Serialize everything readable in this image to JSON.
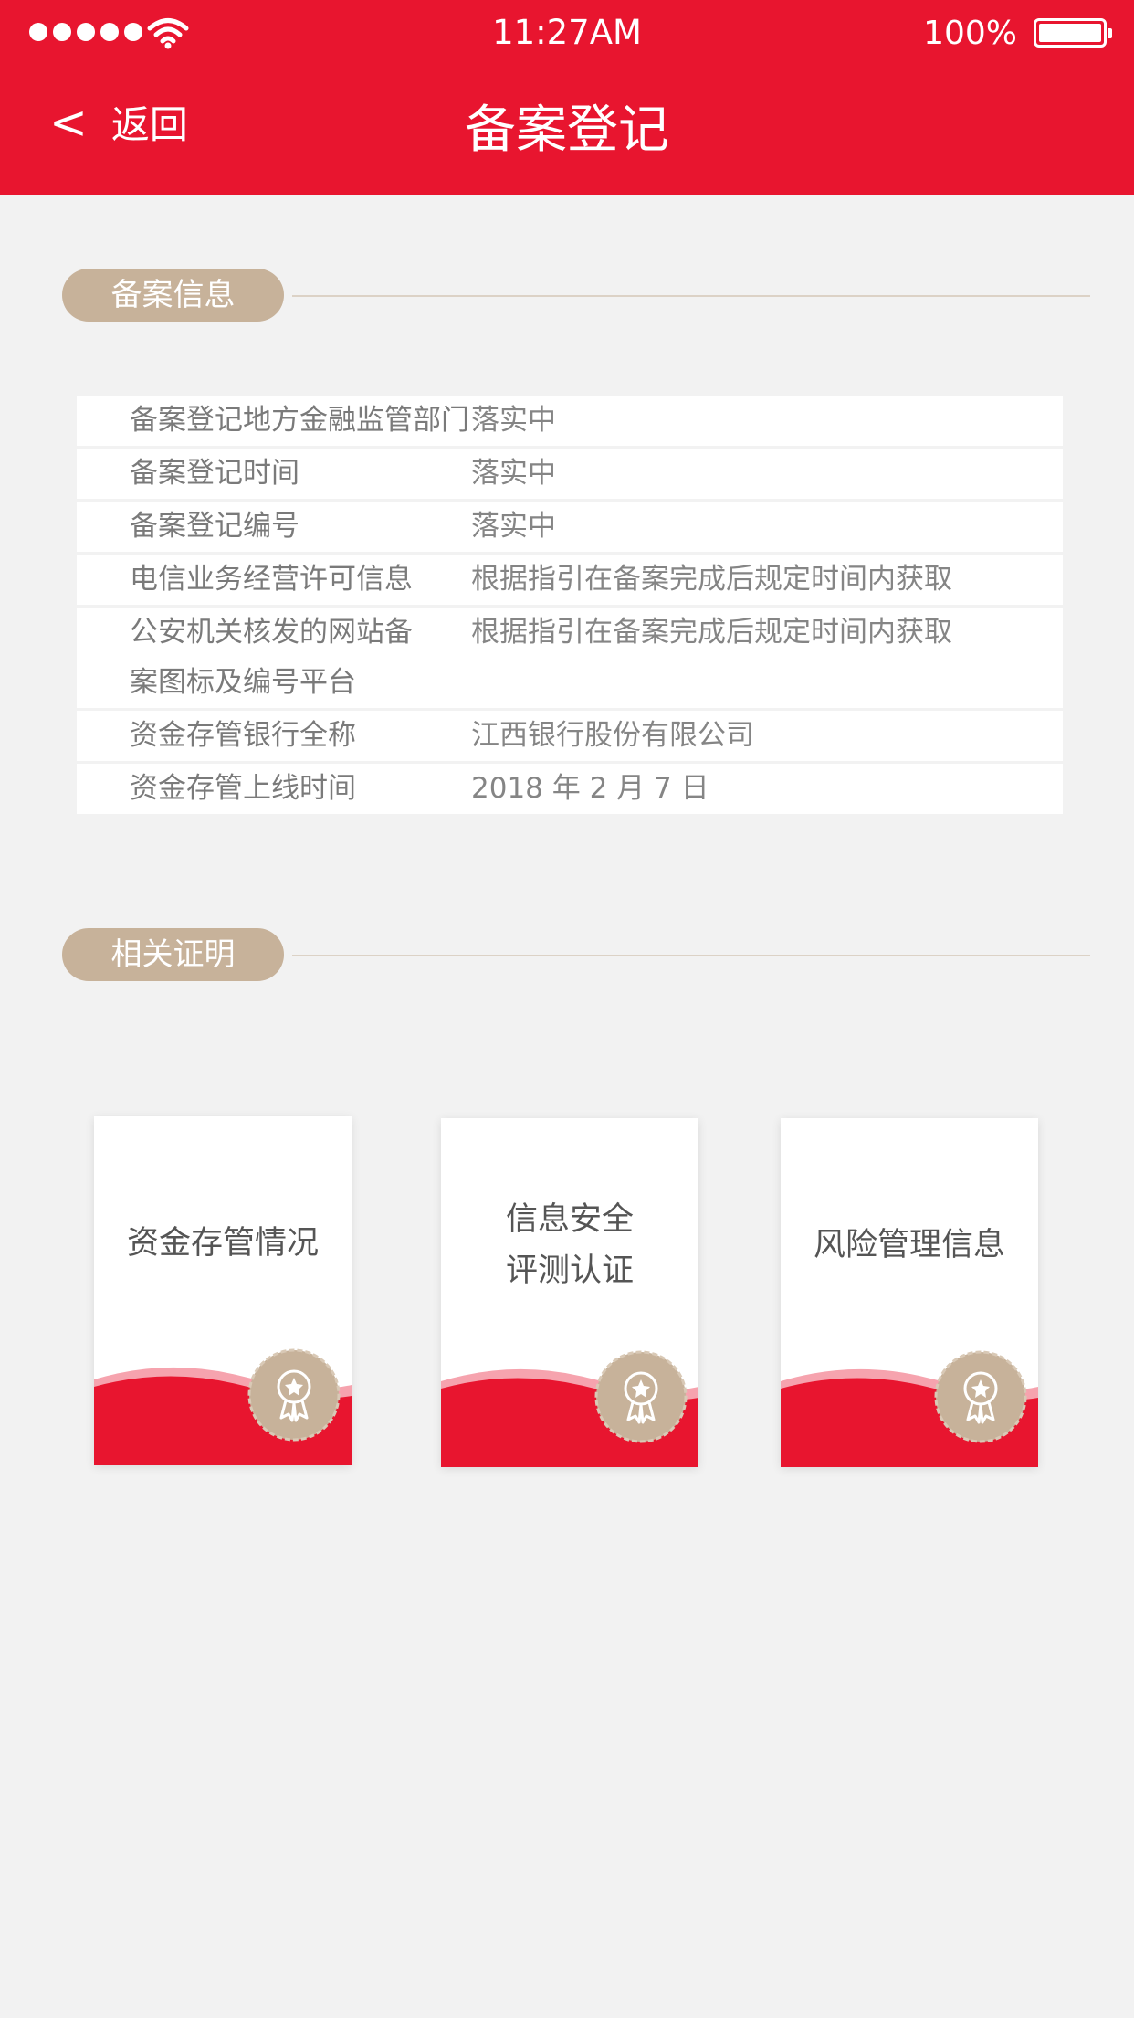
{
  "status_bar": {
    "time": "11:27AM",
    "battery": "100%"
  },
  "nav": {
    "back_label": "返回",
    "title": "备案登记"
  },
  "section1": {
    "title": "备案信息",
    "rows": [
      {
        "label": "备案登记地方金融监管部门",
        "value": "落实中"
      },
      {
        "label": "备案登记时间",
        "value": "落实中"
      },
      {
        "label": "备案登记编号",
        "value": "落实中"
      },
      {
        "label": "电信业务经营许可信息",
        "value": "根据指引在备案完成后规定时间内获取"
      },
      {
        "label": "公安机关核发的网站备案图标及编号平台",
        "value": "根据指引在备案完成后规定时间内获取"
      },
      {
        "label": "资金存管银行全称",
        "value": "江西银行股份有限公司"
      },
      {
        "label": "资金存管上线时间",
        "value": "2018 年 2 月 7 日"
      }
    ]
  },
  "section2": {
    "title": "相关证明",
    "cards": [
      {
        "title": "资金存管情况"
      },
      {
        "title": "信息安全\n评测认证"
      },
      {
        "title": "风险管理信息"
      }
    ]
  },
  "colors": {
    "brand_red": "#e8152f",
    "accent_tan": "#c7b29a",
    "background": "#f2f2f2"
  },
  "icons": [
    "back-chevron-icon",
    "wifi-icon",
    "battery-icon",
    "award-badge-icon"
  ]
}
